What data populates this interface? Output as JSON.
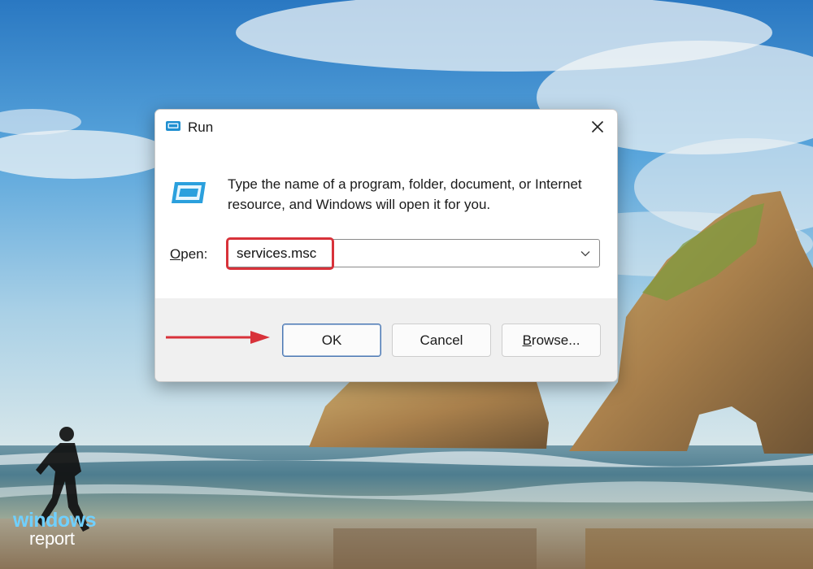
{
  "dialog": {
    "title": "Run",
    "description": "Type the name of a program, folder, document, or Internet resource, and Windows will open it for you.",
    "open_label_accel": "O",
    "open_label_rest": "pen:",
    "open_value": "services.msc",
    "buttons": {
      "ok": "OK",
      "cancel": "Cancel",
      "browse_accel": "B",
      "browse_rest": "rowse..."
    },
    "icons": {
      "title": "run-app-icon",
      "body": "run-app-icon",
      "close": "close-icon",
      "dropdown": "chevron-down-icon"
    }
  },
  "annotations": {
    "highlight_color": "#d8323a",
    "arrow_color": "#d8323a"
  },
  "watermark": {
    "line1": "windows",
    "line2": "report"
  },
  "colors": {
    "dialog_bg": "#ffffff",
    "footer_bg": "#f0f0f0",
    "ok_border": "#4a77b3"
  }
}
